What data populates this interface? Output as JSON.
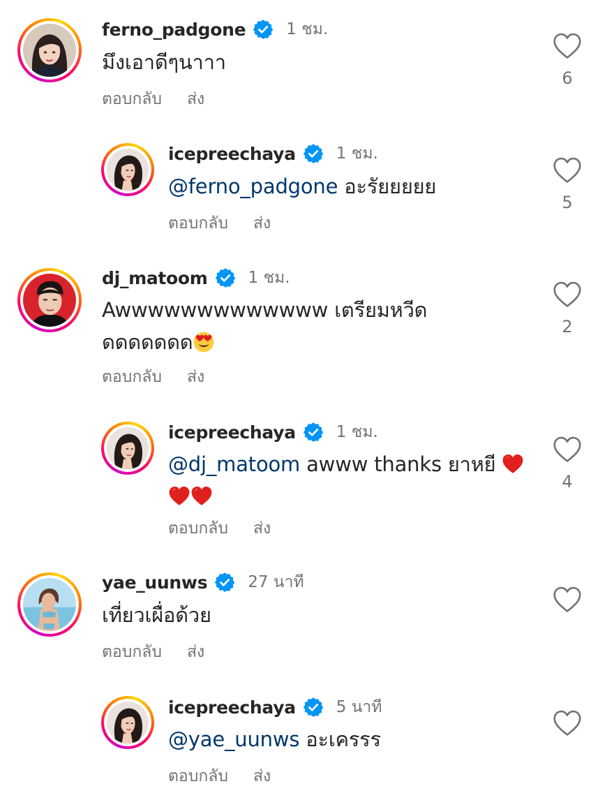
{
  "colors": {
    "text": "#262626",
    "secondary": "#737373",
    "mention": "#00376b",
    "verified": "#0095f6",
    "heart_emoji": "#e0201e"
  },
  "labels": {
    "reply": "ตอบกลับ",
    "send": "ส่ง"
  },
  "comments": [
    {
      "username": "ferno_padgone",
      "verified": true,
      "time": "1 ชม.",
      "text": "มึงเอาดีๆนาาา",
      "likes": "6",
      "is_reply": false,
      "avatar_icon": "avatar-woman-dark-hair"
    },
    {
      "username": "icepreechaya",
      "verified": true,
      "time": "1 ชม.",
      "mention": "@ferno_padgone",
      "text": " อะรัยยยยย",
      "likes": "5",
      "is_reply": true,
      "avatar_icon": "avatar-woman-profile"
    },
    {
      "username": "dj_matoom",
      "verified": true,
      "time": "1 ชม.",
      "text_line1": "Awwwwwwwwwwwww เตรียมหวีด",
      "text_line2": "ดดดดดดด",
      "emoji": "heart-eyes-emoji",
      "likes": "2",
      "is_reply": false,
      "avatar_icon": "avatar-man-red-background"
    },
    {
      "username": "icepreechaya",
      "verified": true,
      "time": "1 ชม.",
      "mention": "@dj_matoom",
      "text": " awww thanks ยาหยี ",
      "emoji": "red-heart-emoji",
      "likes": "4",
      "is_reply": true,
      "avatar_icon": "avatar-woman-profile"
    },
    {
      "username": "yae_uunws",
      "verified": true,
      "time": "27 นาที",
      "text": "เที่ยวเผื่อด้วย",
      "likes": "",
      "is_reply": false,
      "avatar_icon": "avatar-woman-beach"
    },
    {
      "username": "icepreechaya",
      "verified": true,
      "time": "5 นาที",
      "mention": "@yae_uunws",
      "text": " อะเครรร",
      "likes": "",
      "is_reply": true,
      "avatar_icon": "avatar-woman-profile"
    }
  ]
}
